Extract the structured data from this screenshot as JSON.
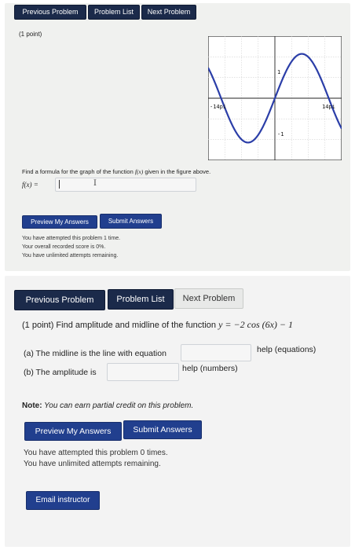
{
  "top": {
    "nav": {
      "previous": "Previous Problem",
      "list": "Problem List",
      "next": "Next Problem"
    },
    "points": "(1 point)",
    "graph": {
      "x_left_label": "-14pi",
      "x_right_label": "14pi",
      "y_top_label": "1",
      "y_bottom_label": "-1",
      "xlim": [
        -17,
        17
      ],
      "ylim": [
        -1.4,
        1.4
      ],
      "curve": "y = sin(3x/14)"
    },
    "prompt_prefix": "Find a formula for the graph of the function ",
    "prompt_func": "f(x)",
    "prompt_suffix": " given in the figure above.",
    "answer_label": "f(x) =",
    "answer_value": "",
    "preview_button": "Preview My Answers",
    "submit_button": "Submit Answers",
    "status": [
      "You have attempted this problem 1 time.",
      "Your overall recorded score is 0%.",
      "You have unlimited attempts remaining."
    ]
  },
  "bottom": {
    "nav": {
      "previous": "Previous Problem",
      "list": "Problem List",
      "next": "Next Problem"
    },
    "prompt": "(1 point) Find amplitude and midline of the function ",
    "prompt_math": "y = −2 cos (6x) − 1",
    "part_a": "(a) The midline is the line with equation",
    "part_a_value": "",
    "help_equations": "help (equations)",
    "part_b": "(b) The amplitude is",
    "part_b_value": "",
    "help_numbers": "help (numbers)",
    "note_label": "Note:",
    "note_text": " You can earn partial credit on this problem.",
    "preview_button": "Preview My Answers",
    "submit_button": "Submit Answers",
    "status": [
      "You have attempted this problem 0 times.",
      "You have unlimited attempts remaining."
    ],
    "email_button": "Email instructor"
  }
}
